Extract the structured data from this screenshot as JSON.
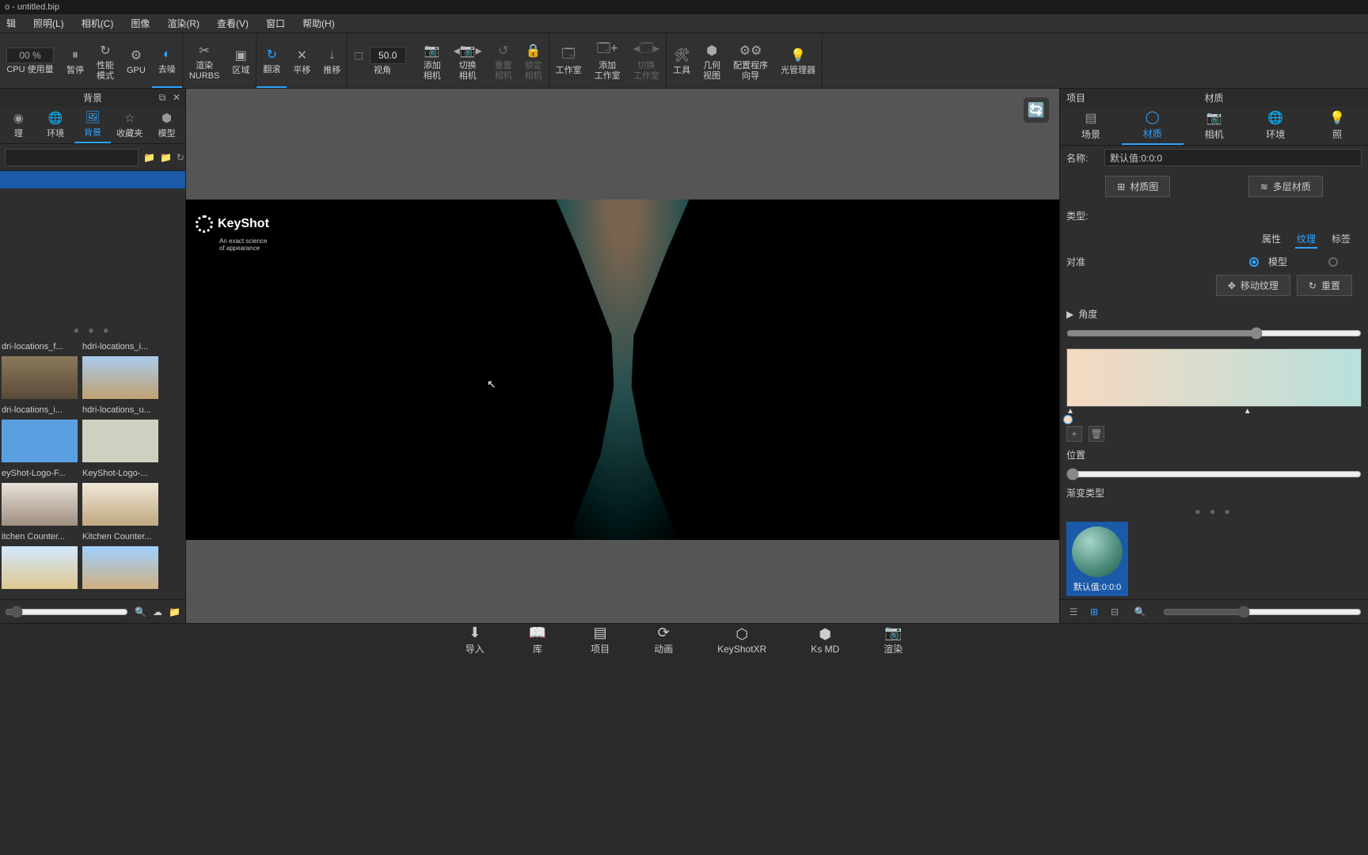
{
  "title": "o - untitled.bip",
  "menu": [
    "照明(L)",
    "相机(C)",
    "图像",
    "渲染(R)",
    "查看(V)",
    "窗口",
    "帮助(H)"
  ],
  "toolbar": {
    "zoom": "00 %",
    "cpu": "CPU 使用量",
    "pause": "暂停",
    "perf": "性能\n模式",
    "gpu": "GPU",
    "denoise": "去噪",
    "nurbs": "渲染\nNURBS",
    "region": "区域",
    "reload": "翻滚",
    "pan": "平移",
    "dolly": "推移",
    "fov_val": "50.0",
    "fov": "视角",
    "addcam": "添加\n相机",
    "swcam": "切换\n相机",
    "resetcam": "重置\n相机",
    "lockcam": "锁定\n相机",
    "workspace": "工作室",
    "addws": "添加\n工作室",
    "swws": "切换\n工作室",
    "tools": "工具",
    "geoview": "几何\n视图",
    "cfgwiz": "配置程序\n向导",
    "lightmgr": "光管理器"
  },
  "leftPanel": {
    "title": "背景",
    "tabs": [
      "理",
      "环境",
      "背景",
      "收藏夹",
      "模型"
    ],
    "thumbs": [
      {
        "cap": "dri-locations_f..."
      },
      {
        "cap": "hdri-locations_i..."
      },
      {
        "cap": "dri-locations_i..."
      },
      {
        "cap": "hdri-locations_u..."
      },
      {
        "cap": "eyShot-Logo-F..."
      },
      {
        "cap": "KeyShot-Logo-..."
      },
      {
        "cap": "itchen Counter..."
      },
      {
        "cap": "Kitchen Counter..."
      }
    ]
  },
  "logo": {
    "text": "KeyShot",
    "sub": "An exact science of appearance"
  },
  "rightPanel": {
    "hdr_l": "项目",
    "hdr_c": "材质",
    "tabs": [
      "场景",
      "材质",
      "相机",
      "环境",
      "照"
    ],
    "name_lbl": "名称:",
    "name_val": "默认值:0:0:0",
    "matgraph": "材质图",
    "multilayer": "多层材质",
    "type_lbl": "类型:",
    "subtabs": [
      "属性",
      "纹理",
      "标签"
    ],
    "align_lbl": "对准",
    "align_opt": "模型",
    "move_tex": "移动纹理",
    "reset": "重置",
    "angle": "角度",
    "position": "位置",
    "gradtype": "渐变类型",
    "preview_cap": "默认值:0:0:0"
  },
  "bottom": [
    "导入",
    "库",
    "项目",
    "动画",
    "KeyShotXR",
    "Ks MD",
    "渲染"
  ]
}
